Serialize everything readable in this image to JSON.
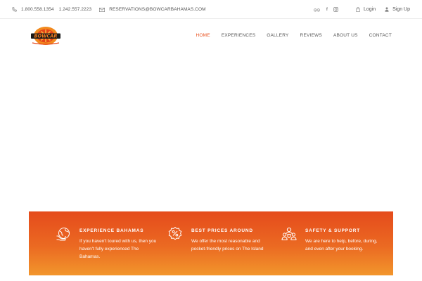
{
  "topbar": {
    "phone1": "1.800.558.1354",
    "phone2": "1.242.557.2223",
    "email": "RESERVATIONS@BOWCARBAHAMAS.COM",
    "login": "Login",
    "signup": "Sign Up",
    "social": [
      "tripadvisor-icon",
      "facebook-icon",
      "instagram-icon"
    ]
  },
  "header": {
    "logo_text": "BOWCAR",
    "nav": [
      {
        "label": "HOME",
        "active": true
      },
      {
        "label": "EXPERIENCES",
        "active": false
      },
      {
        "label": "GALLERY",
        "active": false
      },
      {
        "label": "REVIEWS",
        "active": false
      },
      {
        "label": "ABOUT US",
        "active": false
      },
      {
        "label": "CONTACT",
        "active": false
      }
    ]
  },
  "features": [
    {
      "icon": "globe-hand-icon",
      "title": "EXPERIENCE BAHAMAS",
      "description": "If you haven't toured with us, then you haven't fully experienced The Bahamas."
    },
    {
      "icon": "percent-badge-icon",
      "title": "BEST PRICES AROUND",
      "description": "We offer the most reasonable and pocket-friendly prices on The Island"
    },
    {
      "icon": "support-team-icon",
      "title": "SAFETY & SUPPORT",
      "description": "We are here to help, before, during, and even after your booking."
    }
  ],
  "colors": {
    "accent": "#e84e1b",
    "band_top": "#e54b1c",
    "band_bottom": "#f2962c"
  }
}
